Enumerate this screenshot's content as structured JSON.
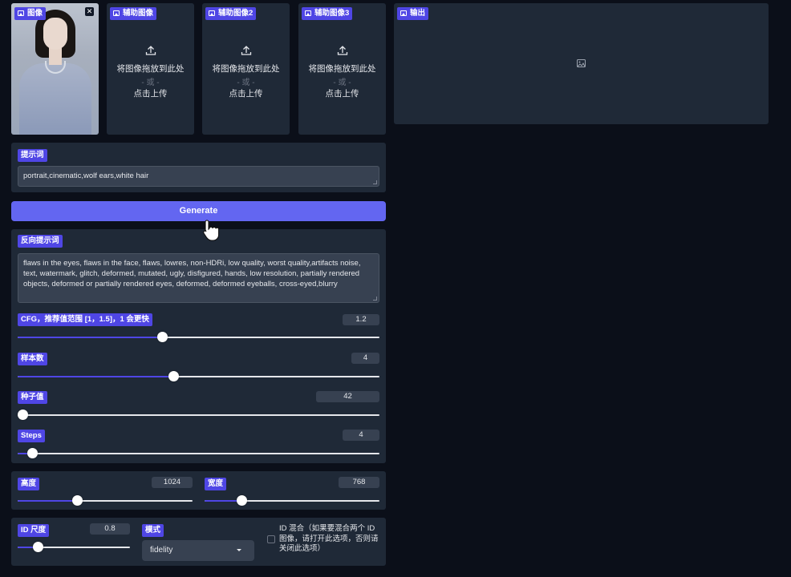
{
  "image_panel": {
    "label": "图像",
    "close": "✕"
  },
  "aux_panels": [
    {
      "label": "辅助图像",
      "drop_text": "将图像拖放到此处",
      "or_text": "- 或 -",
      "click_text": "点击上传"
    },
    {
      "label": "辅助图像2",
      "drop_text": "将图像拖放到此处",
      "or_text": "- 或 -",
      "click_text": "点击上传"
    },
    {
      "label": "辅助图像3",
      "drop_text": "将图像拖放到此处",
      "or_text": "- 或 -",
      "click_text": "点击上传"
    }
  ],
  "output_panel": {
    "label": "输出"
  },
  "prompt": {
    "label": "提示词",
    "value": "portrait,cinematic,wolf ears,white hair"
  },
  "generate": {
    "label": "Generate"
  },
  "negative_prompt": {
    "label": "反向提示词",
    "value": "flaws in the eyes, flaws in the face, flaws, lowres, non-HDRi, low quality, worst quality,artifacts noise, text, watermark, glitch, deformed, mutated, ugly, disfigured, hands, low resolution, partially rendered objects,  deformed or partially rendered eyes, deformed, deformed eyeballs, cross-eyed,blurry"
  },
  "sliders": {
    "cfg": {
      "label": "CFG，推荐值范围 [1，1.5]，1 会更快",
      "value": "1.2",
      "fraction": 0.4
    },
    "samples": {
      "label": "样本数",
      "value": "4",
      "fraction": 0.43
    },
    "seed": {
      "label": "种子值",
      "value": "42",
      "fraction": 0.0
    },
    "steps": {
      "label": "Steps",
      "value": "4",
      "fraction": 0.04
    },
    "height": {
      "label": "高度",
      "value": "1024",
      "fraction": 0.34
    },
    "width": {
      "label": "宽度",
      "value": "768",
      "fraction": 0.21
    },
    "id_scale": {
      "label": "ID 尺度",
      "value": "0.8",
      "fraction": 0.18
    }
  },
  "mode": {
    "label": "模式",
    "selected": "fidelity"
  },
  "id_mix": {
    "text": "ID 混合（如果要混合两个 ID 图像，请打开此选项，否则请关闭此选项）"
  }
}
